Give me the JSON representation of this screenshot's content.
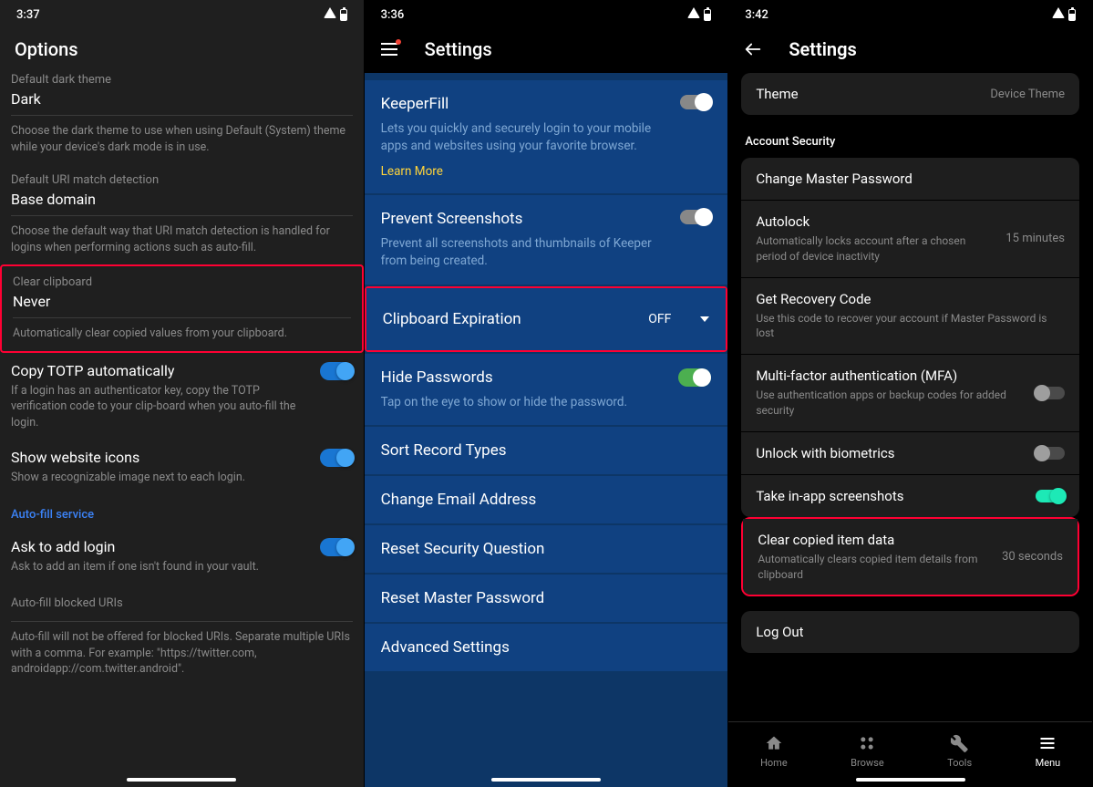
{
  "phone1": {
    "time": "3:37",
    "title": "Options",
    "darkTheme": {
      "label": "Default dark theme",
      "value": "Dark",
      "desc": "Choose the dark theme to use when using Default (System) theme while your device's dark mode is in use."
    },
    "uriMatch": {
      "label": "Default URI match detection",
      "value": "Base domain",
      "desc": "Choose the default way that URI match detection is handled for logins when performing actions such as auto-fill."
    },
    "clearClipboard": {
      "label": "Clear clipboard",
      "value": "Never",
      "desc": "Automatically clear copied values from your clipboard."
    },
    "copyTotp": {
      "title": "Copy TOTP automatically",
      "desc": "If a login has an authenticator key, copy the TOTP verification code to your clip-board when you auto-fill the login."
    },
    "showIcons": {
      "title": "Show website icons",
      "desc": "Show a recognizable image next to each login."
    },
    "autofillHeader": "Auto-fill service",
    "askAdd": {
      "title": "Ask to add login",
      "desc": "Ask to add an item if one isn't found in your vault."
    },
    "blockedHeader": "Auto-fill blocked URIs",
    "blockedDesc": "Auto-fill will not be offered for blocked URIs. Separate multiple URIs with a comma. For example: \"https://twitter.com, androidapp://com.twitter.android\"."
  },
  "phone2": {
    "time": "3:36",
    "title": "Settings",
    "keeperfill": {
      "title": "KeeperFill",
      "desc": "Lets you quickly and securely login to your mobile apps and websites using your favorite browser.",
      "link": "Learn More"
    },
    "preventSS": {
      "title": "Prevent Screenshots",
      "desc": "Prevent all screenshots and thumbnails of Keeper from being created."
    },
    "clipboard": {
      "title": "Clipboard Expiration",
      "value": "OFF"
    },
    "hidePw": {
      "title": "Hide Passwords",
      "desc": "Tap on the eye to show or hide the password."
    },
    "sortRecords": "Sort Record Types",
    "changeEmail": "Change Email Address",
    "resetSec": "Reset Security Question",
    "resetMaster": "Reset Master Password",
    "advanced": "Advanced Settings"
  },
  "phone3": {
    "time": "3:42",
    "title": "Settings",
    "theme": {
      "title": "Theme",
      "value": "Device Theme"
    },
    "sectionLabel": "Account Security",
    "changePw": "Change Master Password",
    "autolock": {
      "title": "Autolock",
      "value": "15 minutes",
      "desc": "Automatically locks account after a chosen period of device inactivity"
    },
    "recovery": {
      "title": "Get Recovery Code",
      "desc": "Use this code to recover your account if Master Password is lost"
    },
    "mfa": {
      "title": "Multi-factor authentication (MFA)",
      "desc": "Use authentication apps or backup codes for added security"
    },
    "biometrics": "Unlock with biometrics",
    "screenshots": "Take in-app screenshots",
    "clearCopied": {
      "title": "Clear copied item data",
      "value": "30 seconds",
      "desc": "Automatically clears copied item details from clipboard"
    },
    "logout": "Log Out",
    "nav": {
      "home": "Home",
      "browse": "Browse",
      "tools": "Tools",
      "menu": "Menu"
    }
  }
}
